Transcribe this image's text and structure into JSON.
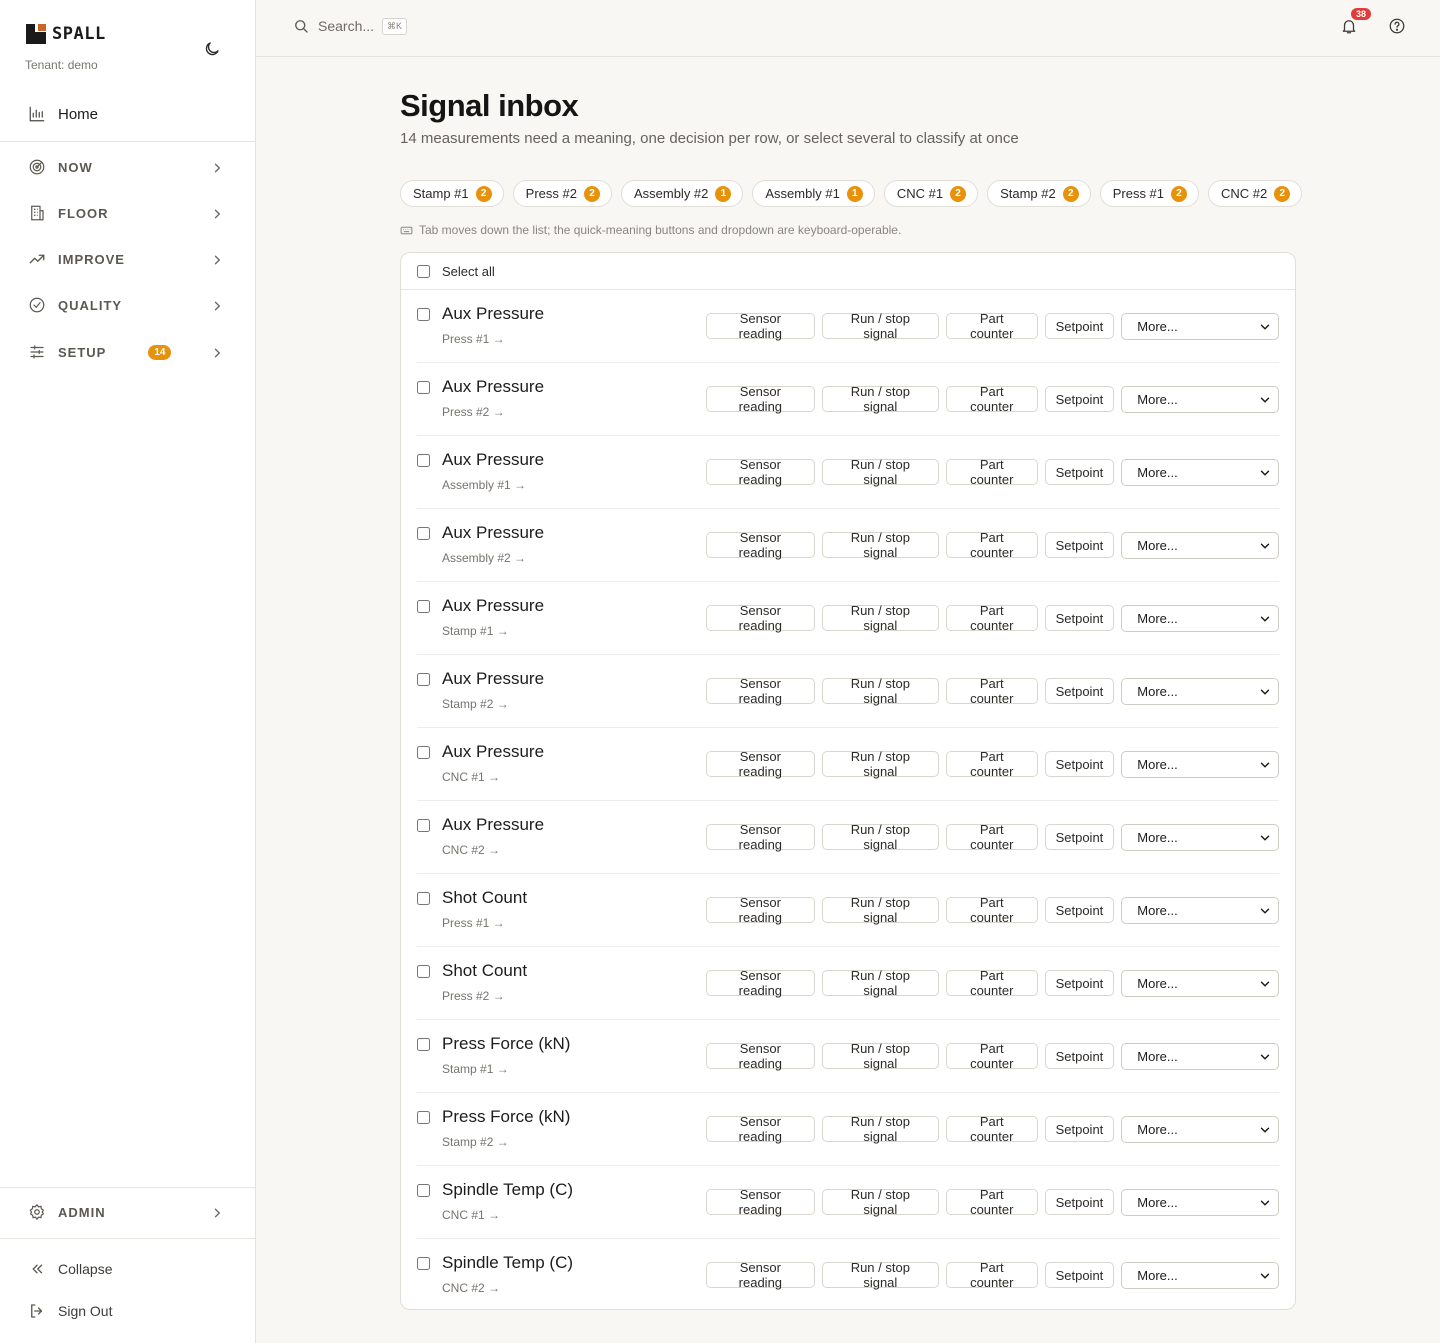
{
  "sidebar": {
    "brand": "SPALL",
    "tenant": "Tenant: demo",
    "home_label": "Home",
    "groups": [
      {
        "label": "NOW",
        "icon": "radar-icon"
      },
      {
        "label": "FLOOR",
        "icon": "building-icon"
      },
      {
        "label": "IMPROVE",
        "icon": "trending-up-icon"
      },
      {
        "label": "QUALITY",
        "icon": "check-circle-icon"
      },
      {
        "label": "SETUP",
        "icon": "sliders-icon",
        "badge": "14"
      }
    ],
    "admin_label": "ADMIN",
    "collapse_label": "Collapse",
    "signout_label": "Sign Out"
  },
  "topbar": {
    "search_placeholder": "Search...",
    "search_shortcut": "⌘K",
    "notifications_count": "38"
  },
  "main": {
    "title": "Signal inbox",
    "subtitle": "14 measurements need a meaning, one decision per row, or select several to classify at once",
    "hint": "Tab moves down the list; the quick-meaning buttons and dropdown are keyboard-operable.",
    "select_all": "Select all",
    "chips": [
      {
        "label": "Stamp #1",
        "count": "2"
      },
      {
        "label": "Press #2",
        "count": "2"
      },
      {
        "label": "Assembly #2",
        "count": "1"
      },
      {
        "label": "Assembly #1",
        "count": "1"
      },
      {
        "label": "CNC #1",
        "count": "2"
      },
      {
        "label": "Stamp #2",
        "count": "2"
      },
      {
        "label": "Press #1",
        "count": "2"
      },
      {
        "label": "CNC #2",
        "count": "2"
      }
    ],
    "quick_actions": [
      "Sensor reading",
      "Run / stop signal",
      "Part counter",
      "Setpoint"
    ],
    "more_label": "More...",
    "rows": [
      {
        "name": "Aux Pressure",
        "machine": "Press #1 →"
      },
      {
        "name": "Aux Pressure",
        "machine": "Press #2 →"
      },
      {
        "name": "Aux Pressure",
        "machine": "Assembly #1 →"
      },
      {
        "name": "Aux Pressure",
        "machine": "Assembly #2 →"
      },
      {
        "name": "Aux Pressure",
        "machine": "Stamp #1 →"
      },
      {
        "name": "Aux Pressure",
        "machine": "Stamp #2 →"
      },
      {
        "name": "Aux Pressure",
        "machine": "CNC #1 →"
      },
      {
        "name": "Aux Pressure",
        "machine": "CNC #2 →"
      },
      {
        "name": "Shot Count",
        "machine": "Press #1 →"
      },
      {
        "name": "Shot Count",
        "machine": "Press #2 →"
      },
      {
        "name": "Press Force (kN)",
        "machine": "Stamp #1 →"
      },
      {
        "name": "Press Force (kN)",
        "machine": "Stamp #2 →"
      },
      {
        "name": "Spindle Temp (C)",
        "machine": "CNC #1 →"
      },
      {
        "name": "Spindle Temp (C)",
        "machine": "CNC #2 →"
      }
    ]
  },
  "colors": {
    "accent": "#e8920c",
    "notification": "#e23b3b",
    "brand_mark": "#c8662a"
  }
}
